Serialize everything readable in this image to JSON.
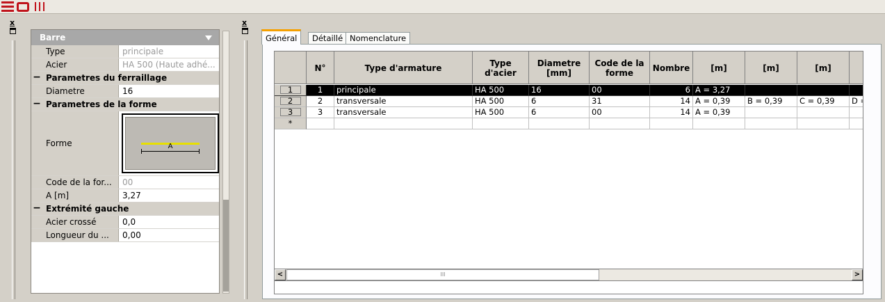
{
  "props": {
    "header": "Barre",
    "rows": [
      {
        "label": "Type",
        "value": "principale"
      },
      {
        "label": "Acier",
        "value": "HA 500 (Haute adhé..."
      },
      {
        "category": "Parametres du ferraillage"
      },
      {
        "label": "Diametre",
        "value": "16"
      },
      {
        "category": "Parametres de la forme"
      },
      {
        "label": "Forme",
        "shape_label": "A"
      },
      {
        "label": "Code de la for...",
        "value": "00"
      },
      {
        "label": "A [m]",
        "value": "3,27"
      },
      {
        "category": "Extrémité gauche"
      },
      {
        "label": "Acier crossé",
        "value": "0,0"
      },
      {
        "label": "Longueur du ...",
        "value": "0,00"
      }
    ]
  },
  "tabs": [
    {
      "label": "Général"
    },
    {
      "label": "Détaillé"
    },
    {
      "label": "Nomenclature"
    }
  ],
  "grid": {
    "headers": [
      "",
      "N°",
      "Type d'armature",
      "Type d'acier",
      "Diametre [mm]",
      "Code de la forme",
      "Nombre",
      "[m]",
      "[m]",
      "[m]",
      ""
    ],
    "rows": [
      {
        "rh": "1",
        "cells": [
          "1",
          "principale",
          "HA 500",
          "16",
          "00",
          "6",
          "A = 3,27",
          "",
          "",
          ""
        ]
      },
      {
        "rh": "2",
        "cells": [
          "2",
          "transversale",
          "HA 500",
          "6",
          "31",
          "14",
          "A = 0,39",
          "B = 0,39",
          "C = 0,39",
          "D ="
        ]
      },
      {
        "rh": "3",
        "cells": [
          "3",
          "transversale",
          "HA 500",
          "6",
          "00",
          "14",
          "A = 0,39",
          "",
          "",
          ""
        ]
      },
      {
        "rh": "*",
        "cells": [
          "",
          "",
          "",
          "",
          "",
          "",
          "",
          "",
          "",
          ""
        ]
      }
    ],
    "selected_row": 0
  },
  "scroll": {
    "left_arrow": "<",
    "right_arrow": ">",
    "thumb_grip": "III"
  }
}
